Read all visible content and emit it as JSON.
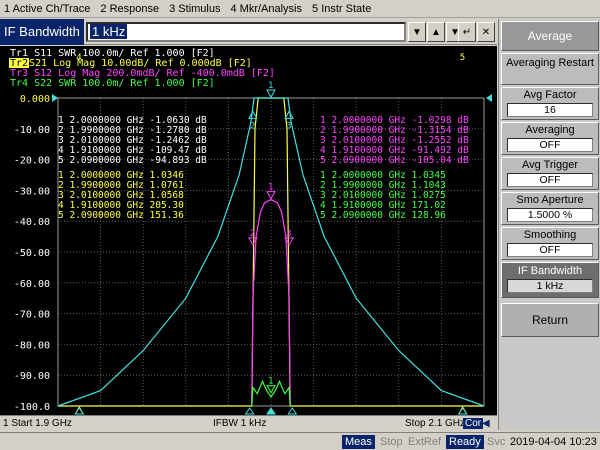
{
  "menu": [
    "1 Active Ch/Trace",
    "2 Response",
    "3 Stimulus",
    "4 Mkr/Analysis",
    "5 Instr State"
  ],
  "entry": {
    "title": "IF Bandwidth",
    "value": "1 kHz"
  },
  "softkeys": {
    "average": "Average",
    "averaging_restart": "Averaging Restart",
    "avg_factor": {
      "label": "Avg Factor",
      "value": "16"
    },
    "averaging": {
      "label": "Averaging",
      "value": "OFF"
    },
    "avg_trigger": {
      "label": "Avg Trigger",
      "value": "OFF"
    },
    "smo_aperture": {
      "label": "Smo Aperture",
      "value": "1.5000  %"
    },
    "smoothing": {
      "label": "Smoothing",
      "value": "OFF"
    },
    "if_bandwidth": {
      "label": "IF Bandwidth",
      "value": "1 kHz"
    },
    "return": "Return"
  },
  "traces": [
    {
      "text": "Tr1  S11  SWR 100.0m/ Ref 1.000 [F2]",
      "color": "#ffffff"
    },
    {
      "id": "Tr2",
      "text": " S21  Log Mag 10.00dB/ Ref 0.000dB [F2]",
      "color": "#ffff40"
    },
    {
      "text": "Tr3  S12  Log Mag 200.0mdB/ Ref -400.0mdB [F2]",
      "color": "#ff40ff"
    },
    {
      "text": "Tr4  S22  SWR 100.0m/ Ref 1.000 [F2]",
      "color": "#40ff40"
    }
  ],
  "y_axis": {
    "ticks": [
      "0.000",
      "-10.00",
      "-20.00",
      "-30.00",
      "-40.00",
      "-50.00",
      "-60.00",
      "-70.00",
      "-80.00",
      "-90.00",
      "-100.0"
    ]
  },
  "markers": {
    "s21": [
      "1   2.0000000  GHz  -1.0630  dB",
      "2   1.9900000  GHz  -1.2780  dB",
      "3   2.0100000  GHz  -1.2462  dB",
      "4   1.9100000  GHz  -109.47  dB",
      "5   2.0900000  GHz  -94.893  dB"
    ],
    "s11": [
      "1   2.0000000  GHz   1.0346",
      "2   1.9900000  GHz   1.0761",
      "3   2.0100000  GHz   1.0568",
      "4   1.9100000  GHz   205.30",
      "5   2.0900000  GHz   151.36"
    ],
    "s12": [
      "1   2.0000000  GHz  -1.0298  dB",
      "2   1.9900000  GHz  -1.3154  dB",
      "3   2.0100000  GHz  -1.2552  dB",
      "4   1.9100000  GHz  -91.492  dB",
      "5   2.0900000  GHz  -105.04  dB"
    ],
    "s22": [
      "1   2.0000000  GHz   1.0345",
      "2   1.9900000  GHz   1.1043",
      "3   2.0100000  GHz   1.0275",
      "4   1.9100000  GHz   171.02",
      "5   2.0900000  GHz   128.96"
    ]
  },
  "channel_bar": {
    "start": "1  Start 1.9 GHz",
    "ifbw": "IFBW 1 kHz",
    "stop": "Stop 2.1 GHz",
    "cor": "Cor"
  },
  "status": {
    "meas": "Meas",
    "stop": "Stop",
    "extref": "ExtRef",
    "ready": "Ready",
    "svc": "Svc",
    "time": "2019-04-04 10:23"
  },
  "chart_data": {
    "type": "line",
    "x_range_ghz": [
      1.9,
      2.1
    ],
    "ylim": [
      -100,
      0
    ],
    "series": [
      {
        "name": "S21",
        "color": "#ffff40",
        "x": [
          1.9,
          1.991,
          1.9925,
          1.994,
          2.006,
          2.0075,
          2.009,
          2.1
        ],
        "y": [
          -100,
          -100,
          -10,
          0,
          0,
          -10,
          -100,
          -100
        ]
      },
      {
        "name": "S11",
        "color": "#40e0e0",
        "x": [
          1.9,
          1.92,
          1.94,
          1.96,
          1.975,
          1.985,
          1.9905,
          1.992,
          2.008,
          2.0095,
          2.015,
          2.025,
          2.04,
          2.06,
          2.08,
          2.1
        ],
        "y": [
          -100,
          -95,
          -82,
          -65,
          -45,
          -25,
          -8,
          0,
          0,
          -8,
          -25,
          -45,
          -65,
          -82,
          -95,
          -100
        ]
      },
      {
        "name": "S12",
        "color": "#ff40ff",
        "x": [
          1.991,
          1.9915,
          1.993,
          1.995,
          1.997,
          2.0,
          2.003,
          2.005,
          2.007,
          2.0085,
          2.009
        ],
        "y": [
          -100,
          -65,
          -45,
          -37,
          -34,
          -33,
          -34,
          -37,
          -45,
          -65,
          -100
        ]
      },
      {
        "name": "S22",
        "color": "#40ff40",
        "x": [
          1.991,
          1.9915,
          1.9935,
          1.996,
          1.998,
          2.0,
          2.002,
          2.004,
          2.0065,
          2.0085,
          2.009
        ],
        "y": [
          -100,
          -94,
          -96,
          -92,
          -95,
          -97,
          -95,
          -92,
          -96,
          -94,
          -100
        ]
      }
    ]
  }
}
